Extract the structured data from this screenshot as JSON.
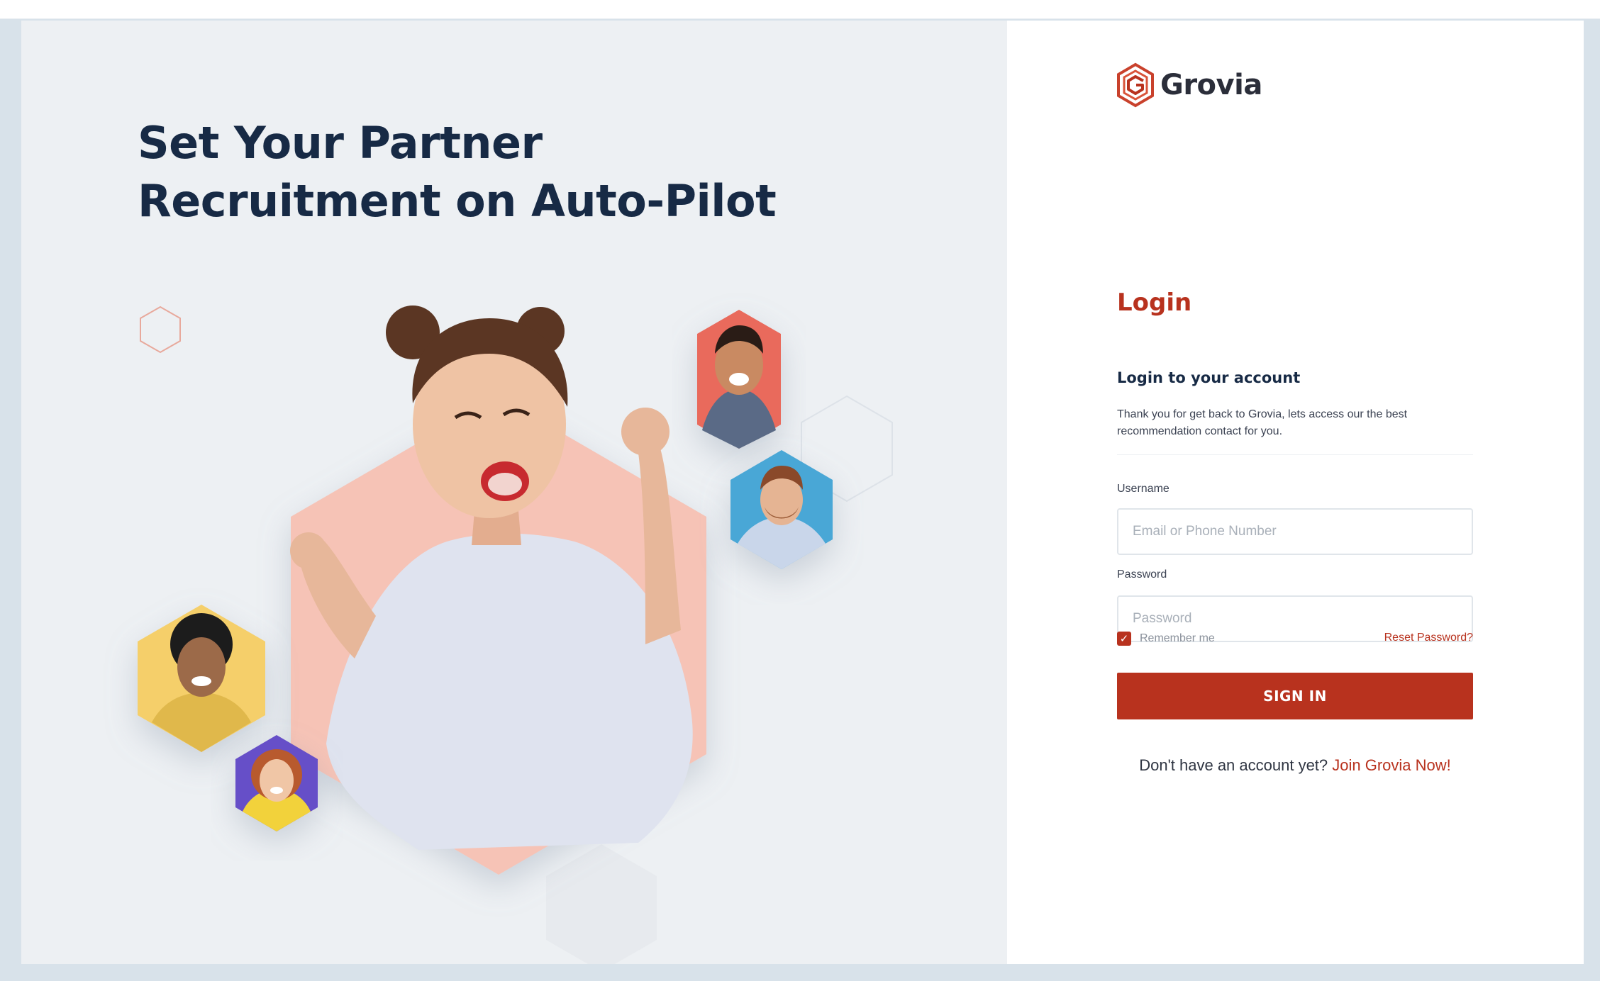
{
  "hero": {
    "headline_line1": "Set Your Partner",
    "headline_line2": "Recruitment on Auto-Pilot"
  },
  "brand": {
    "name": "Grovia",
    "logo_icon": "hexagon-g-logo"
  },
  "login": {
    "title": "Login",
    "subtitle": "Login to your account",
    "description": "Thank you for get back to Grovia, lets access our the best recommendation contact for you.",
    "username_label": "Username",
    "username_placeholder": "Email or Phone Number",
    "username_value": "",
    "password_label": "Password",
    "password_placeholder": "Password",
    "password_value": "",
    "remember_label": "Remember me",
    "remember_checked": true,
    "reset_link": "Reset Password?",
    "signin_label": "SIGN IN",
    "signup_prompt": "Don't have an account yet?",
    "signup_link": "Join Grovia Now!"
  },
  "colors": {
    "brand_red": "#b8321e",
    "heading_navy": "#172a45",
    "left_panel_bg": "#edf0f3",
    "hex_peach": "#f6c3b6",
    "hex_coral": "#e96a5b",
    "hex_blue": "#4aa7d6",
    "hex_yellow": "#f5cf6a",
    "hex_purple": "#6650c8"
  }
}
